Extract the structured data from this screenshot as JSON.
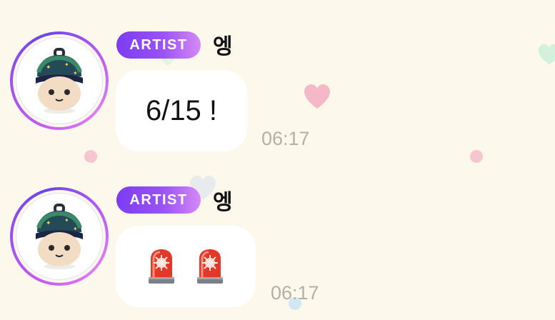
{
  "colors": {
    "background": "#fdf8ec",
    "badge_start": "#7b3cf2",
    "badge_end": "#d689f7",
    "bubble": "#ffffff",
    "timestamp": "#b4b0a8",
    "avatar_ring": "#9a4ff0"
  },
  "messages": [
    {
      "badge": "ARTIST",
      "sender": "엥",
      "text": "6/15 !",
      "time": "06:17",
      "avatar_icon": "knit-doll-avatar-icon"
    },
    {
      "badge": "ARTIST",
      "sender": "엥",
      "emojis": [
        "police-light-icon",
        "police-light-icon"
      ],
      "time": "06:17",
      "avatar_icon": "knit-doll-avatar-icon"
    }
  ]
}
